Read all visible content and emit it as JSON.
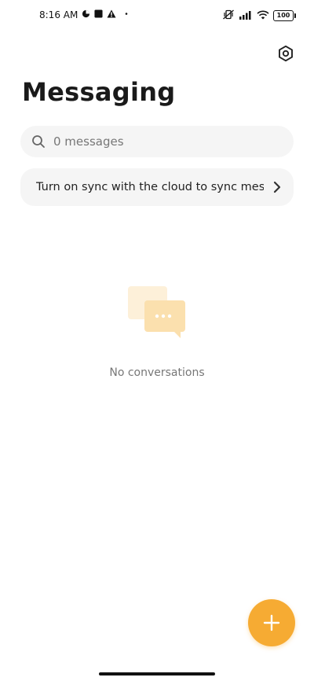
{
  "status_bar": {
    "time": "8:16 AM",
    "battery": "100"
  },
  "header": {
    "title": "Messaging"
  },
  "search": {
    "placeholder": "0 messages"
  },
  "sync_banner": {
    "text": "Turn on sync with the cloud to sync messages"
  },
  "empty_state": {
    "text": "No conversations"
  },
  "colors": {
    "accent": "#f6ab33",
    "surface": "#f5f5f5"
  },
  "icons": {
    "settings": "settings-hexagon-icon",
    "search": "search-icon",
    "chevron": "chevron-right-icon",
    "compose": "plus-icon",
    "empty": "chat-bubbles-icon"
  }
}
